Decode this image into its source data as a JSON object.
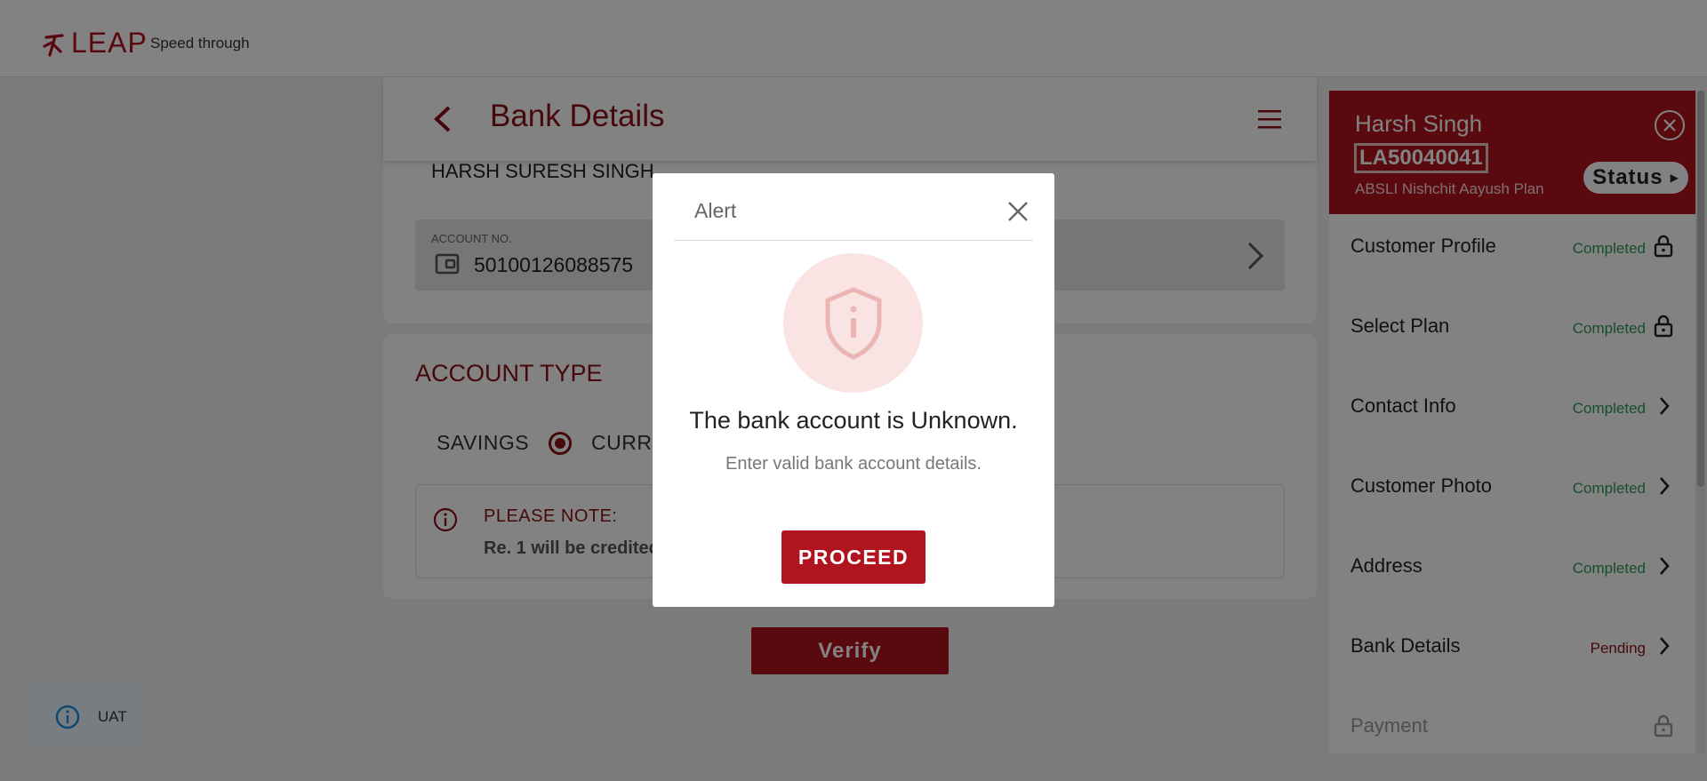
{
  "header": {
    "logo_text": "LEAP",
    "tagline": "Speed through"
  },
  "page": {
    "title": "Bank Details",
    "account_holder_name": "HARSH SURESH SINGH",
    "account_no_label": "ACCOUNT NO.",
    "account_no_value": "50100126088575",
    "account_type_title": "ACCOUNT TYPE",
    "account_type_options": [
      "SAVINGS",
      "CURREN"
    ],
    "note_title": "PLEASE NOTE:",
    "note_text": "Re. 1 will be credited",
    "verify_label": "Verify"
  },
  "side_panel": {
    "customer_name": "Harsh Singh",
    "application_no": "LA50040041",
    "plan_name": "ABSLI Nishchit Aayush Plan",
    "status_label": "Status",
    "steps": [
      {
        "label": "Customer Profile",
        "status": "Completed",
        "icon": "lock-icon"
      },
      {
        "label": "Select Plan",
        "status": "Completed",
        "icon": "lock-icon"
      },
      {
        "label": "Contact Info",
        "status": "Completed",
        "icon": "chevron-right-icon"
      },
      {
        "label": "Customer Photo",
        "status": "Completed",
        "icon": "chevron-right-icon"
      },
      {
        "label": "Address",
        "status": "Completed",
        "icon": "chevron-right-icon"
      },
      {
        "label": "Bank Details",
        "status": "Pending",
        "icon": "chevron-right-icon"
      },
      {
        "label": "Payment",
        "status": "",
        "icon": "lock-icon"
      }
    ]
  },
  "env_badge": {
    "label": "UAT"
  },
  "modal": {
    "title": "Alert",
    "message": "The bank account is Unknown.",
    "sub_message": "Enter valid bank account details.",
    "proceed_label": "PROCEED"
  },
  "colors": {
    "brand_red": "#b0141e",
    "dark_red": "#8b1018",
    "completed_green": "#2c9a56"
  }
}
